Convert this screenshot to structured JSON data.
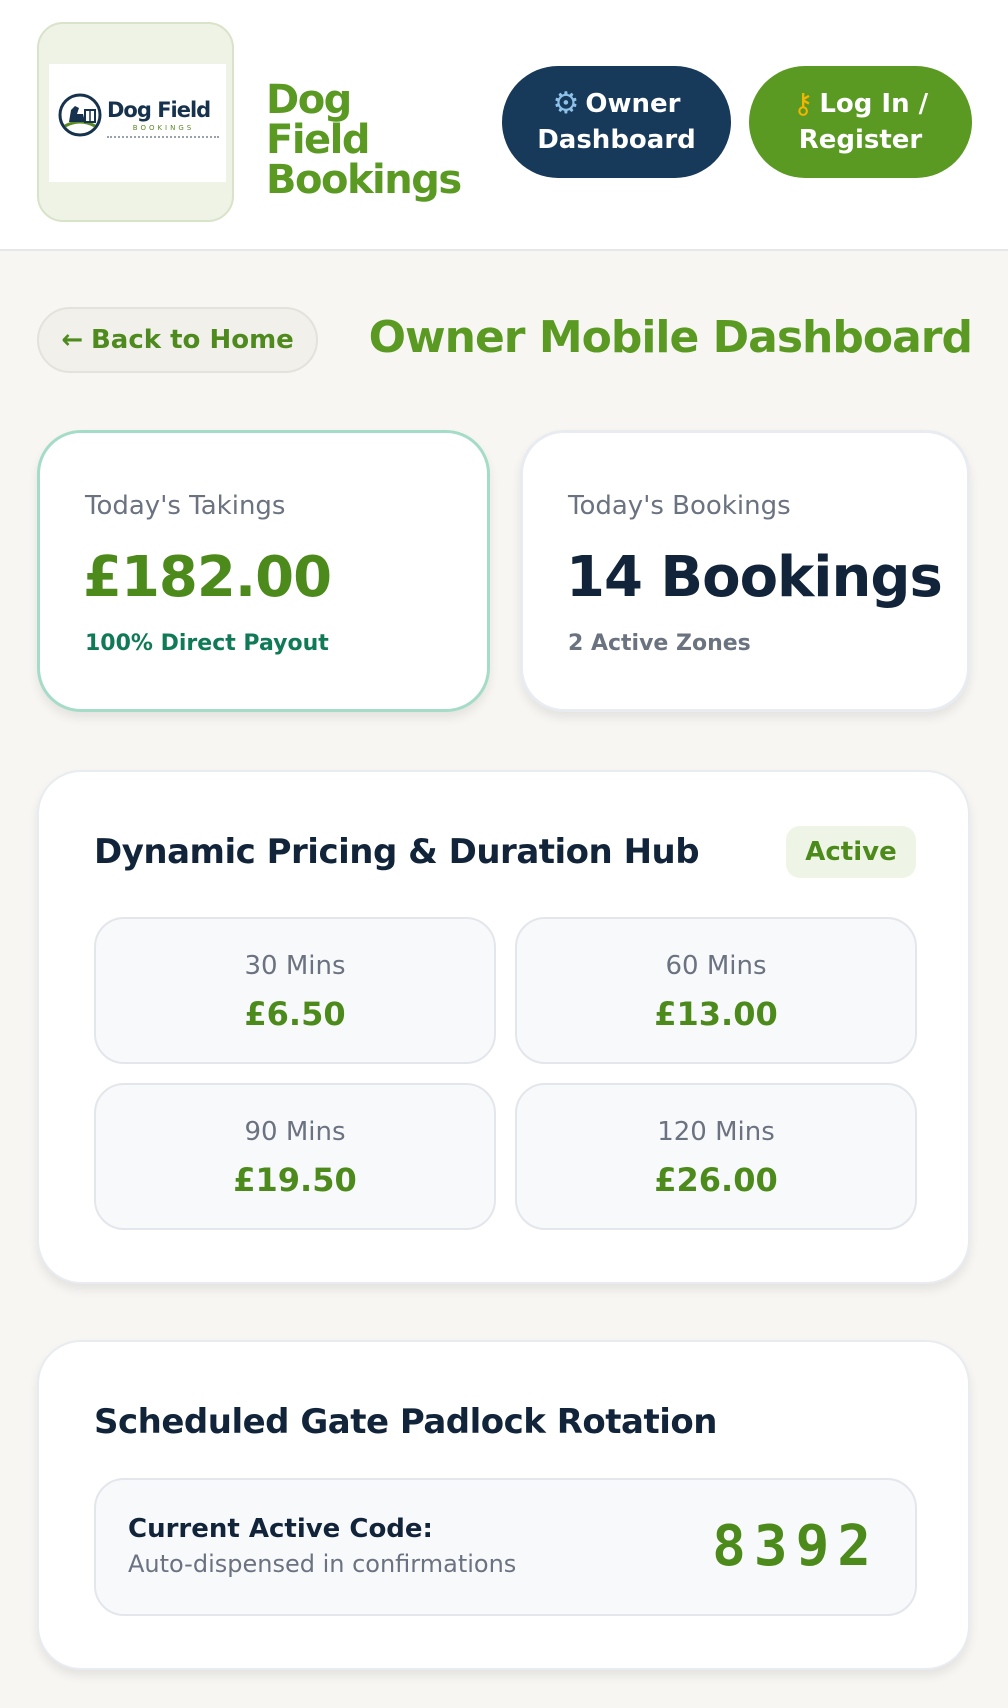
{
  "header": {
    "logo": {
      "word": "Dog Field",
      "sub": "BOOKINGS"
    },
    "brand_name": "Dog Field Bookings",
    "owner_button": {
      "icon": "gear-icon",
      "line1": "Owner",
      "line2": "Dashboard"
    },
    "login_button": {
      "icon": "key-icon",
      "line1": "Log In /",
      "line2": "Register"
    }
  },
  "nav": {
    "back_label": "Back to Home",
    "back_arrow": "←",
    "page_title": "Owner Mobile Dashboard"
  },
  "stats": {
    "takings": {
      "label": "Today's Takings",
      "value": "£182.00",
      "sub": "100% Direct Payout"
    },
    "bookings": {
      "label": "Today's Bookings",
      "value": "14 Bookings",
      "sub": "2 Active Zones"
    }
  },
  "pricing": {
    "title": "Dynamic Pricing & Duration Hub",
    "status": "Active",
    "tiles": [
      {
        "duration": "30 Mins",
        "price": "£6.50"
      },
      {
        "duration": "60 Mins",
        "price": "£13.00"
      },
      {
        "duration": "90 Mins",
        "price": "£19.50"
      },
      {
        "duration": "120 Mins",
        "price": "£26.00"
      }
    ]
  },
  "gate": {
    "title": "Scheduled Gate Padlock Rotation",
    "code_label": "Current Active Code:",
    "code_desc": "Auto-dispensed in confirmations",
    "code_value": "8392"
  },
  "colors": {
    "brand_green": "#5a9a23",
    "navy": "#17395a",
    "teal_border": "#a5dcc8"
  }
}
